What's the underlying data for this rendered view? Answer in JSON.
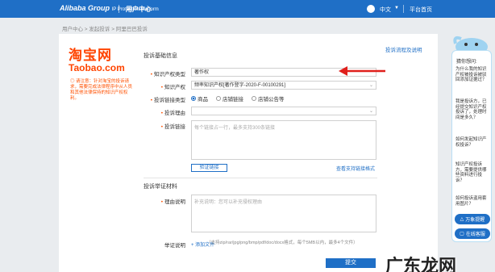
{
  "header": {
    "logo": "Alibaba Group",
    "logo_sub": "IP Protection Platform",
    "center_title": "用户中心",
    "language": "中文",
    "home_link": "平台首页"
  },
  "breadcrumb": "用户中心  >  发起投诉  >  阿里巴巴投诉",
  "brand": {
    "cn": "淘宝网",
    "en": "Taobao.com"
  },
  "notice": "◎ 请注意：针对淘宝的投诉请求，需要完成法律程序中从人员和其他法律保持的知识产权权利。",
  "section_basic": "投诉基础信息",
  "guide_link": "投诉流程及说明",
  "form": {
    "ip_type_label": "知识产权类型",
    "ip_type_value": "著作权",
    "ip_label": "知识产权",
    "ip_value": "频率知识产权[著作登字-2020-F-00100291]",
    "link_type_label": "投诉链接类型",
    "link_type_options": [
      "商品",
      "店铺链接",
      "店铺公告等"
    ],
    "reason_label": "投诉理由",
    "links_label": "投诉链接",
    "links_placeholder": "每个链接占一行，最多支持300条链接",
    "verify_button": "验证链接",
    "view_link": "查看支持链接格式"
  },
  "section_evidence": "投诉举证材料",
  "evidence": {
    "reason_label": "理由说明",
    "reason_placeholder": "补充说明：您可以补充侵权理由",
    "attach_label": "举证说明",
    "add_file": "+ 添加文件",
    "attach_hint": "（支持zip/rar/jpg/png/bmp/pdf/doc/docx格式，每个5MB以内，最多4个文件）",
    "submit": "提交"
  },
  "side": {
    "title": "猜你想问:",
    "faqs": [
      "为什么我的知识产权被投诉被驳回添加证据过？",
      "我是投诉方，已经提交知识产权投诉了，处理时间是多久？",
      "如何发起知识产权投诉？",
      "知识产权投诉方，需要提供哪些资料进行投诉？",
      "如何投诉盗用套用图片？"
    ],
    "pill1": "万象提醒",
    "pill2": "在线客服"
  },
  "watermark": "广东龙网",
  "colors": {
    "header": "#1f6fc6",
    "brand": "#ff4400",
    "arrow": "#e0201c"
  }
}
